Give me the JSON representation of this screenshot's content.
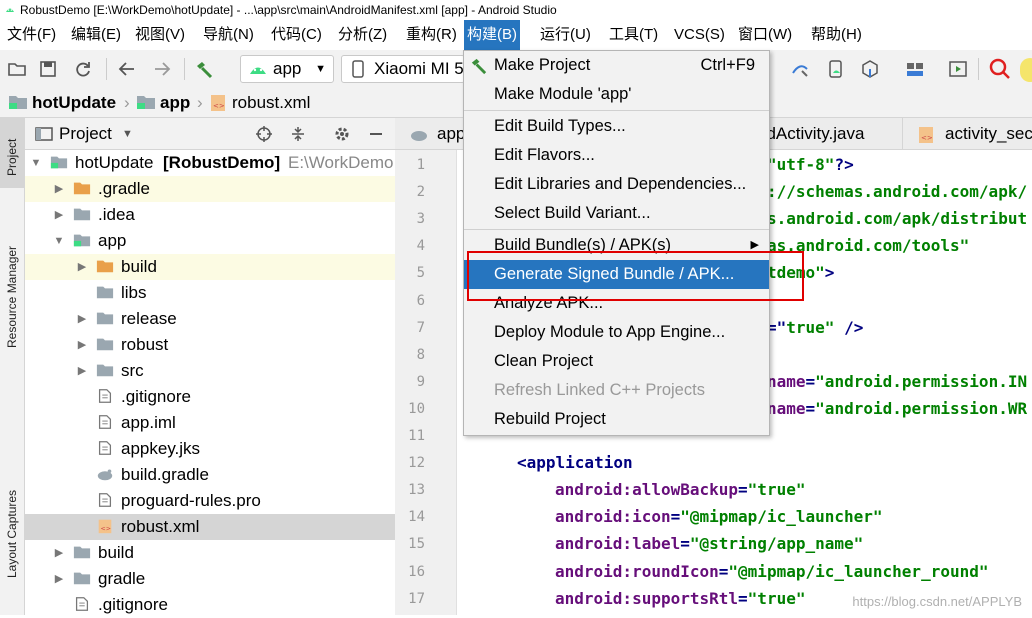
{
  "window": {
    "title": "RobustDemo [E:\\WorkDemo\\hotUpdate] - ...\\app\\src\\main\\AndroidManifest.xml [app] - Android Studio"
  },
  "menubar": {
    "items": [
      "文件(F)",
      "编辑(E)",
      "视图(V)",
      "导航(N)",
      "代码(C)",
      "分析(Z)",
      "重构(R)",
      "构建(B)",
      "运行(U)",
      "工具(T)",
      "VCS(S)",
      "窗口(W)",
      "帮助(H)"
    ],
    "active_index": 7
  },
  "toolbar": {
    "run_config": "app",
    "device": "Xiaomi MI 5"
  },
  "breadcrumb": {
    "items": [
      "hotUpdate",
      "app",
      "robust.xml"
    ]
  },
  "left_strip": {
    "tabs": [
      "Project",
      "Resource Manager",
      "Layout Captures"
    ]
  },
  "project_panel": {
    "title": "Project",
    "rows": [
      {
        "label": "hotUpdate",
        "bold_suffix": "[RobustDemo]",
        "path": "E:\\WorkDemo",
        "icon": "module-folder-icon",
        "depth": 0,
        "arrow": "down",
        "hl": false,
        "sel": false
      },
      {
        "label": ".gradle",
        "icon": "folder-orange-icon",
        "depth": 1,
        "arrow": "right",
        "hl": true,
        "sel": false
      },
      {
        "label": ".idea",
        "icon": "folder-icon",
        "depth": 1,
        "arrow": "right",
        "hl": false,
        "sel": false
      },
      {
        "label": "app",
        "icon": "module-folder-icon",
        "depth": 1,
        "arrow": "down",
        "hl": false,
        "sel": false
      },
      {
        "label": "build",
        "icon": "folder-orange-icon",
        "depth": 2,
        "arrow": "right",
        "hl": true,
        "sel": false
      },
      {
        "label": "libs",
        "icon": "folder-icon",
        "depth": 2,
        "arrow": "",
        "hl": false,
        "sel": false
      },
      {
        "label": "release",
        "icon": "folder-icon",
        "depth": 2,
        "arrow": "right",
        "hl": false,
        "sel": false
      },
      {
        "label": "robust",
        "icon": "folder-icon",
        "depth": 2,
        "arrow": "right",
        "hl": false,
        "sel": false
      },
      {
        "label": "src",
        "icon": "folder-icon",
        "depth": 2,
        "arrow": "right",
        "hl": false,
        "sel": false
      },
      {
        "label": ".gitignore",
        "icon": "file-icon",
        "depth": 2,
        "arrow": "",
        "hl": false,
        "sel": false
      },
      {
        "label": "app.iml",
        "icon": "file-icon",
        "depth": 2,
        "arrow": "",
        "hl": false,
        "sel": false
      },
      {
        "label": "appkey.jks",
        "icon": "file-icon",
        "depth": 2,
        "arrow": "",
        "hl": false,
        "sel": false
      },
      {
        "label": "build.gradle",
        "icon": "gradle-icon",
        "depth": 2,
        "arrow": "",
        "hl": false,
        "sel": false
      },
      {
        "label": "proguard-rules.pro",
        "icon": "file-icon",
        "depth": 2,
        "arrow": "",
        "hl": false,
        "sel": false
      },
      {
        "label": "robust.xml",
        "icon": "xml-file-icon",
        "depth": 2,
        "arrow": "",
        "hl": false,
        "sel": true
      },
      {
        "label": "build",
        "icon": "folder-icon",
        "depth": 1,
        "arrow": "right",
        "hl": false,
        "sel": false
      },
      {
        "label": "gradle",
        "icon": "folder-icon",
        "depth": 1,
        "arrow": "right",
        "hl": false,
        "sel": false
      },
      {
        "label": ".gitignore",
        "icon": "file-icon",
        "depth": 1,
        "arrow": "",
        "hl": false,
        "sel": false
      }
    ]
  },
  "editor": {
    "tabs": [
      "app",
      "ndActivity.java",
      "activity_seco"
    ],
    "line_numbers": [
      "1",
      "2",
      "3",
      "4",
      "5",
      "6",
      "7",
      "8",
      "9",
      "10",
      "11",
      "12",
      "13",
      "14",
      "15",
      "16",
      "17"
    ],
    "code_lines": [
      [
        [
          "val",
          "\"utf-8\""
        ],
        [
          "tag",
          "?>"
        ]
      ],
      [
        [
          "val",
          "://schemas.android.com/apk/"
        ]
      ],
      [
        [
          "val",
          "s.android.com/apk/distribut"
        ]
      ],
      [
        [
          "val",
          "as.android.com/tools\""
        ]
      ],
      [
        [
          "val",
          "tdemo\""
        ],
        [
          "tag",
          ">"
        ]
      ],
      [],
      [
        [
          "tag",
          "=\""
        ],
        [
          "val",
          "true\""
        ],
        [
          "tag",
          " />"
        ]
      ],
      [],
      [
        [
          "attr",
          "name"
        ],
        [
          "tag",
          "="
        ],
        [
          "val",
          "\"android.permission.IN"
        ]
      ],
      [
        [
          "attr",
          "name"
        ],
        [
          "tag",
          "="
        ],
        [
          "val",
          "\"android.permission.WR"
        ]
      ],
      [],
      [
        [
          "tag",
          "<application"
        ]
      ],
      [
        [
          "ns",
          "android:"
        ],
        [
          "attr",
          "allowBackup"
        ],
        [
          "tag",
          "="
        ],
        [
          "val",
          "\"true\""
        ]
      ],
      [
        [
          "ns",
          "android:"
        ],
        [
          "attr",
          "icon"
        ],
        [
          "tag",
          "="
        ],
        [
          "val",
          "\"@mipmap/ic_launcher\""
        ]
      ],
      [
        [
          "ns",
          "android:"
        ],
        [
          "attr",
          "label"
        ],
        [
          "tag",
          "="
        ],
        [
          "val",
          "\"@string/app_name\""
        ]
      ],
      [
        [
          "ns",
          "android:"
        ],
        [
          "attr",
          "roundIcon"
        ],
        [
          "tag",
          "="
        ],
        [
          "val",
          "\"@mipmap/ic_launcher_round\""
        ]
      ],
      [
        [
          "ns",
          "android:"
        ],
        [
          "attr",
          "supportsRtl"
        ],
        [
          "tag",
          "="
        ],
        [
          "val",
          "\"true\""
        ]
      ]
    ]
  },
  "build_menu": {
    "items": [
      {
        "label": "Make Project",
        "shortcut": "Ctrl+F9",
        "icon": "hammer-icon"
      },
      {
        "label": "Make Module 'app'"
      },
      {
        "sep": true
      },
      {
        "label": "Edit Build Types..."
      },
      {
        "label": "Edit Flavors..."
      },
      {
        "label": "Edit Libraries and Dependencies..."
      },
      {
        "label": "Select Build Variant..."
      },
      {
        "sep": true
      },
      {
        "label": "Build Bundle(s) / APK(s)",
        "submenu": true
      },
      {
        "label": "Generate Signed Bundle / APK...",
        "selected": true
      },
      {
        "label": "Analyze APK..."
      },
      {
        "label": "Deploy Module to App Engine..."
      },
      {
        "label": "Clean Project"
      },
      {
        "label": "Refresh Linked C++ Projects",
        "disabled": true
      },
      {
        "label": "Rebuild Project"
      }
    ]
  },
  "watermark": "https://blog.csdn.net/APPLYB",
  "colors": {
    "menu_selection": "#2675bf",
    "highlight_box": "#e00000",
    "folder_orange": "#e9a04a",
    "folder_gray": "#9aa7b0",
    "android_green": "#3ddc84"
  }
}
